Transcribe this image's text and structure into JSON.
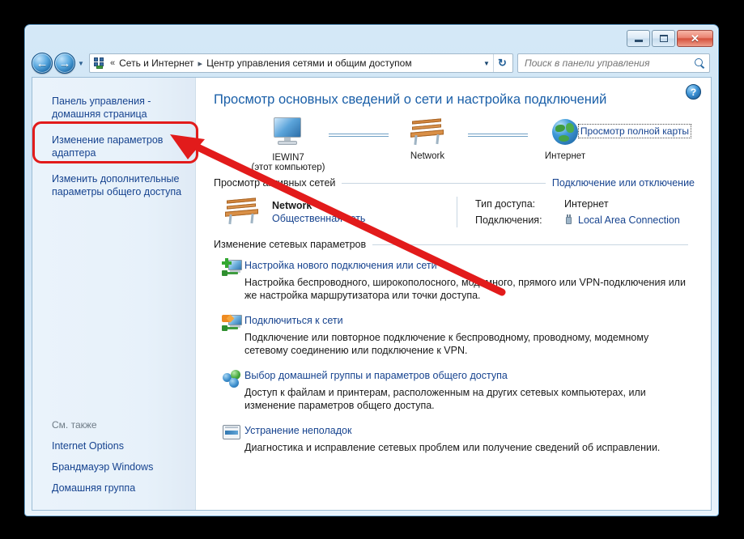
{
  "window": {
    "controls": {
      "minimize": "–",
      "maximize": "□",
      "close": "✕"
    }
  },
  "addressbar": {
    "back_arrow": "←",
    "forward_arrow": "→",
    "history_caret": "▼",
    "chevrons": "«",
    "crumb1": "Сеть и Интернет",
    "separator": "▸",
    "crumb2": "Центр управления сетями и общим доступом",
    "dropdown_caret": "▼",
    "refresh_glyph": "↻"
  },
  "search": {
    "placeholder": "Поиск в панели управления",
    "value": ""
  },
  "sidebar": {
    "links": [
      "Панель управления - домашняя страница",
      "Изменение параметров адаптера",
      "Изменить дополнительные параметры общего доступа"
    ],
    "see_also_header": "См. также",
    "see_also": [
      "Internet Options",
      "Брандмауэр Windows",
      "Домашняя группа"
    ]
  },
  "main": {
    "help_glyph": "?",
    "title": "Просмотр основных сведений о сети и настройка подключений",
    "map": {
      "computer_name": "IEWIN7",
      "computer_sub": "(этот компьютер)",
      "network_name": "Network",
      "internet_name": "Интернет",
      "full_map_link": "Просмотр полной карты"
    },
    "active_networks": {
      "section_title": "Просмотр активных сетей",
      "section_link": "Подключение или отключение",
      "network_name": "Network",
      "network_type": "Общественная сеть",
      "access_label": "Тип доступа:",
      "access_value": "Интернет",
      "connections_label": "Подключения:",
      "connections_value": "Local Area Connection"
    },
    "change_settings": {
      "section_title": "Изменение сетевых параметров",
      "tasks": [
        {
          "link": "Настройка нового подключения или сети",
          "desc": "Настройка беспроводного, широкополосного, модемного, прямого или VPN-подключения или же настройка маршрутизатора или точки доступа."
        },
        {
          "link": "Подключиться к сети",
          "desc": "Подключение или повторное подключение к беспроводному, проводному, модемному сетевому соединению или подключение к VPN."
        },
        {
          "link": "Выбор домашней группы и параметров общего доступа",
          "desc": "Доступ к файлам и принтерам, расположенным на других сетевых компьютерах, или изменение параметров общего доступа."
        },
        {
          "link": "Устранение неполадок",
          "desc": "Диагностика и исправление сетевых проблем или получение сведений об исправлении."
        }
      ]
    }
  },
  "annotation": {
    "color": "#e21b1b",
    "highlight_target": "Изменение параметров адаптера"
  }
}
